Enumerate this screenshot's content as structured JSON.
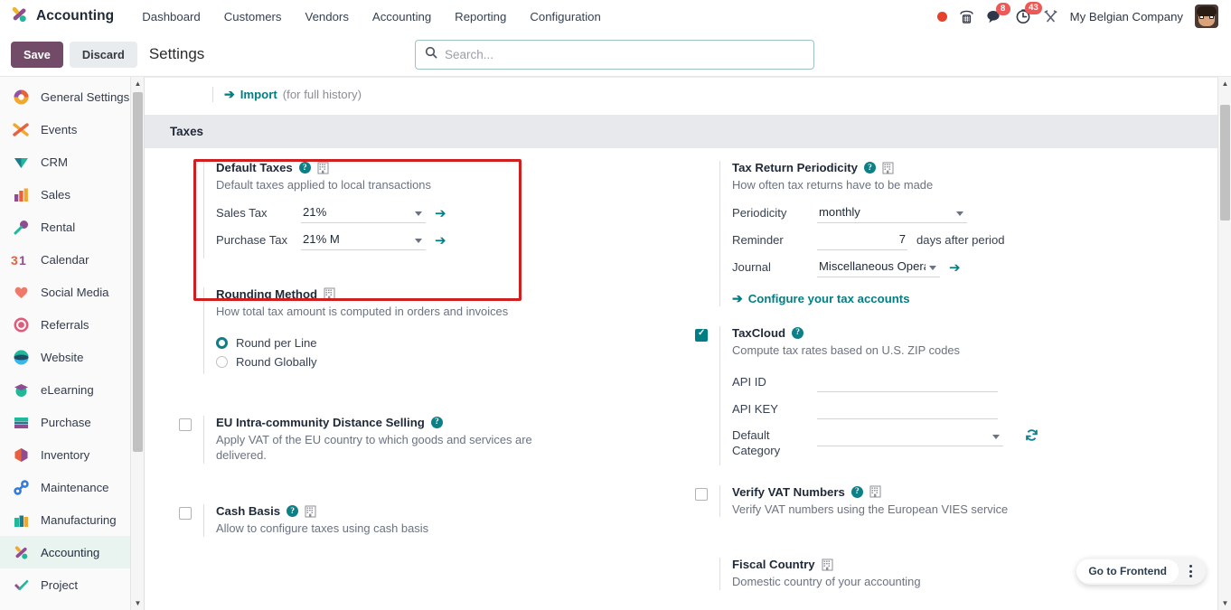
{
  "navbar": {
    "brand": "Accounting",
    "brand_icon": "odoo-accounting-logo-icon",
    "menu": [
      {
        "label": "Dashboard",
        "name": "menu-dashboard"
      },
      {
        "label": "Customers",
        "name": "menu-customers"
      },
      {
        "label": "Vendors",
        "name": "menu-vendors"
      },
      {
        "label": "Accounting",
        "name": "menu-accounting"
      },
      {
        "label": "Reporting",
        "name": "menu-reporting"
      },
      {
        "label": "Configuration",
        "name": "menu-configuration"
      }
    ],
    "status_dot": "recording-dot-icon",
    "phone_icon": "phone-icon",
    "messages_icon": "messages-icon",
    "messages_count": "8",
    "activities_icon": "clock-activities-icon",
    "activities_count": "43",
    "debug_icon": "developer-tools-icon",
    "company": "My Belgian Company",
    "avatar": "user-avatar"
  },
  "control_panel": {
    "save_label": "Save",
    "discard_label": "Discard",
    "page_title": "Settings",
    "search_placeholder": "Search...",
    "search_value": "",
    "search_icon": "search-icon"
  },
  "sidebar": {
    "items": [
      {
        "label": "General Settings",
        "icon": "general-settings-icon",
        "active": false
      },
      {
        "label": "Events",
        "icon": "events-icon",
        "active": false
      },
      {
        "label": "CRM",
        "icon": "crm-icon",
        "active": false
      },
      {
        "label": "Sales",
        "icon": "sales-icon",
        "active": false
      },
      {
        "label": "Rental",
        "icon": "rental-icon",
        "active": false
      },
      {
        "label": "Calendar",
        "icon": "calendar-icon",
        "active": false
      },
      {
        "label": "Social Media",
        "icon": "social-media-icon",
        "active": false
      },
      {
        "label": "Referrals",
        "icon": "referrals-icon",
        "active": false
      },
      {
        "label": "Website",
        "icon": "website-icon",
        "active": false
      },
      {
        "label": "eLearning",
        "icon": "elearning-icon",
        "active": false
      },
      {
        "label": "Purchase",
        "icon": "purchase-icon",
        "active": false
      },
      {
        "label": "Inventory",
        "icon": "inventory-icon",
        "active": false
      },
      {
        "label": "Maintenance",
        "icon": "maintenance-icon",
        "active": false
      },
      {
        "label": "Manufacturing",
        "icon": "manufacturing-icon",
        "active": false
      },
      {
        "label": "Accounting",
        "icon": "accounting-icon",
        "active": true
      },
      {
        "label": "Project",
        "icon": "project-icon",
        "active": false
      }
    ]
  },
  "main": {
    "import_link": "Import",
    "import_suffix": "(for full history)",
    "section_title": "Taxes",
    "default_taxes": {
      "title": "Default Taxes",
      "description": "Default taxes applied to local transactions",
      "sales_tax_label": "Sales Tax",
      "sales_tax_value": "21%",
      "purchase_tax_label": "Purchase Tax",
      "purchase_tax_value": "21% M"
    },
    "tax_return_periodicity": {
      "title": "Tax Return Periodicity",
      "description": "How often tax returns have to be made",
      "periodicity_label": "Periodicity",
      "periodicity_value": "monthly",
      "reminder_label": "Reminder",
      "reminder_value": "7",
      "reminder_suffix": "days after period",
      "journal_label": "Journal",
      "journal_value": "Miscellaneous Operat",
      "configure_link": "Configure your tax accounts"
    },
    "rounding_method": {
      "title": "Rounding Method",
      "description": "How total tax amount is computed in orders and invoices",
      "options": [
        {
          "label": "Round per Line",
          "selected": true
        },
        {
          "label": "Round Globally",
          "selected": false
        }
      ]
    },
    "taxcloud": {
      "title": "TaxCloud",
      "description": "Compute tax rates based on U.S. ZIP codes",
      "checked": true,
      "api_id_label": "API ID",
      "api_id_value": "",
      "api_key_label": "API KEY",
      "api_key_value": "",
      "default_category_label": "Default Category",
      "default_category_value": "",
      "refresh_icon": "refresh-icon"
    },
    "eu_distance_selling": {
      "title": "EU Intra-community Distance Selling",
      "description": "Apply VAT of the EU country to which goods and services are delivered.",
      "checked": false
    },
    "verify_vat": {
      "title": "Verify VAT Numbers",
      "description": "Verify VAT numbers using the European VIES service",
      "checked": false
    },
    "cash_basis": {
      "title": "Cash Basis",
      "description": "Allow to configure taxes using cash basis",
      "checked": false
    },
    "fiscal_country": {
      "title": "Fiscal Country",
      "description": "Domestic country of your accounting"
    }
  },
  "frontend": {
    "label": "Go to Frontend",
    "kebab_icon": "more-options-icon"
  },
  "colors": {
    "accent_teal": "#017e84",
    "primary_purple": "#714b67",
    "highlight_red": "#d11f1f",
    "badge_red": "#eb5a56",
    "band_grey": "#e7e9ed"
  }
}
